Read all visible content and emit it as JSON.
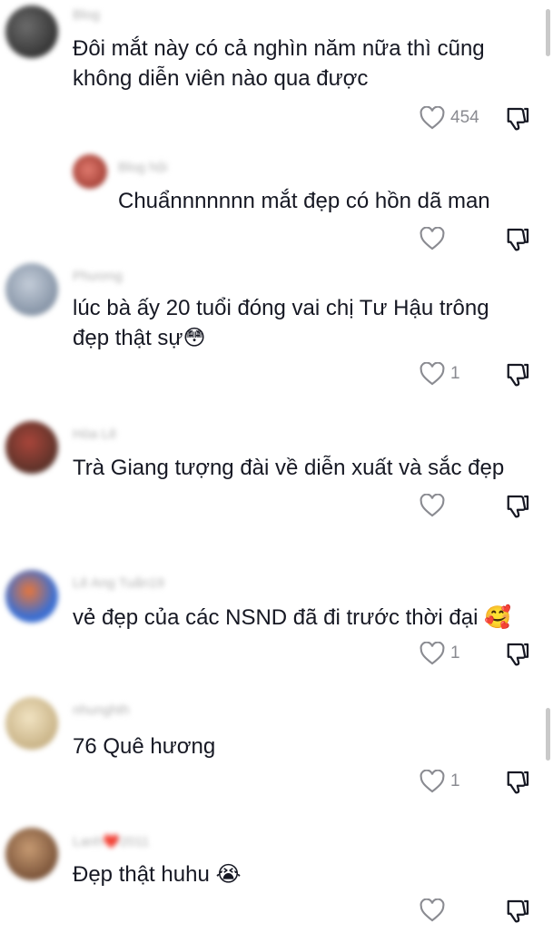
{
  "comments": [
    {
      "username": "Blog",
      "text": "Đôi mắt này có cả nghìn năm nữa thì cũng\nkhông diễn viên nào qua được",
      "likes": "454",
      "avatar_color": "#3a3a3a"
    },
    {
      "username": "Blog hội",
      "text": "Chuẩnnnnnnn mắt đẹp có hồn dã man",
      "likes": "",
      "avatar_color": "#c0392b",
      "is_reply": true
    },
    {
      "username": "Phương",
      "text": "lúc bà ấy 20 tuổi đóng vai chị Tư Hậu trông\nđẹp thật sự😳",
      "likes": "1",
      "avatar_color": "#9aa7b8"
    },
    {
      "username": "Hòa Lê",
      "text": "Trà Giang tượng đài về diễn xuất và sắc đẹp",
      "likes": "",
      "avatar_color": "#5a3a2e"
    },
    {
      "username": "Lê Ang Tuấn19",
      "text": "vẻ đẹp của các NSND đã đi trước thời đại 🥰",
      "likes": "1",
      "avatar_color": "#3d6fd1"
    },
    {
      "username": "nhunghth",
      "text": "76 Quê hương",
      "likes": "1",
      "avatar_color": "#d9c7a3"
    },
    {
      "username": "Lanh❤️2011",
      "text": "Đẹp thật huhu 😭",
      "likes": "",
      "avatar_color": "#7a4a2a"
    }
  ]
}
